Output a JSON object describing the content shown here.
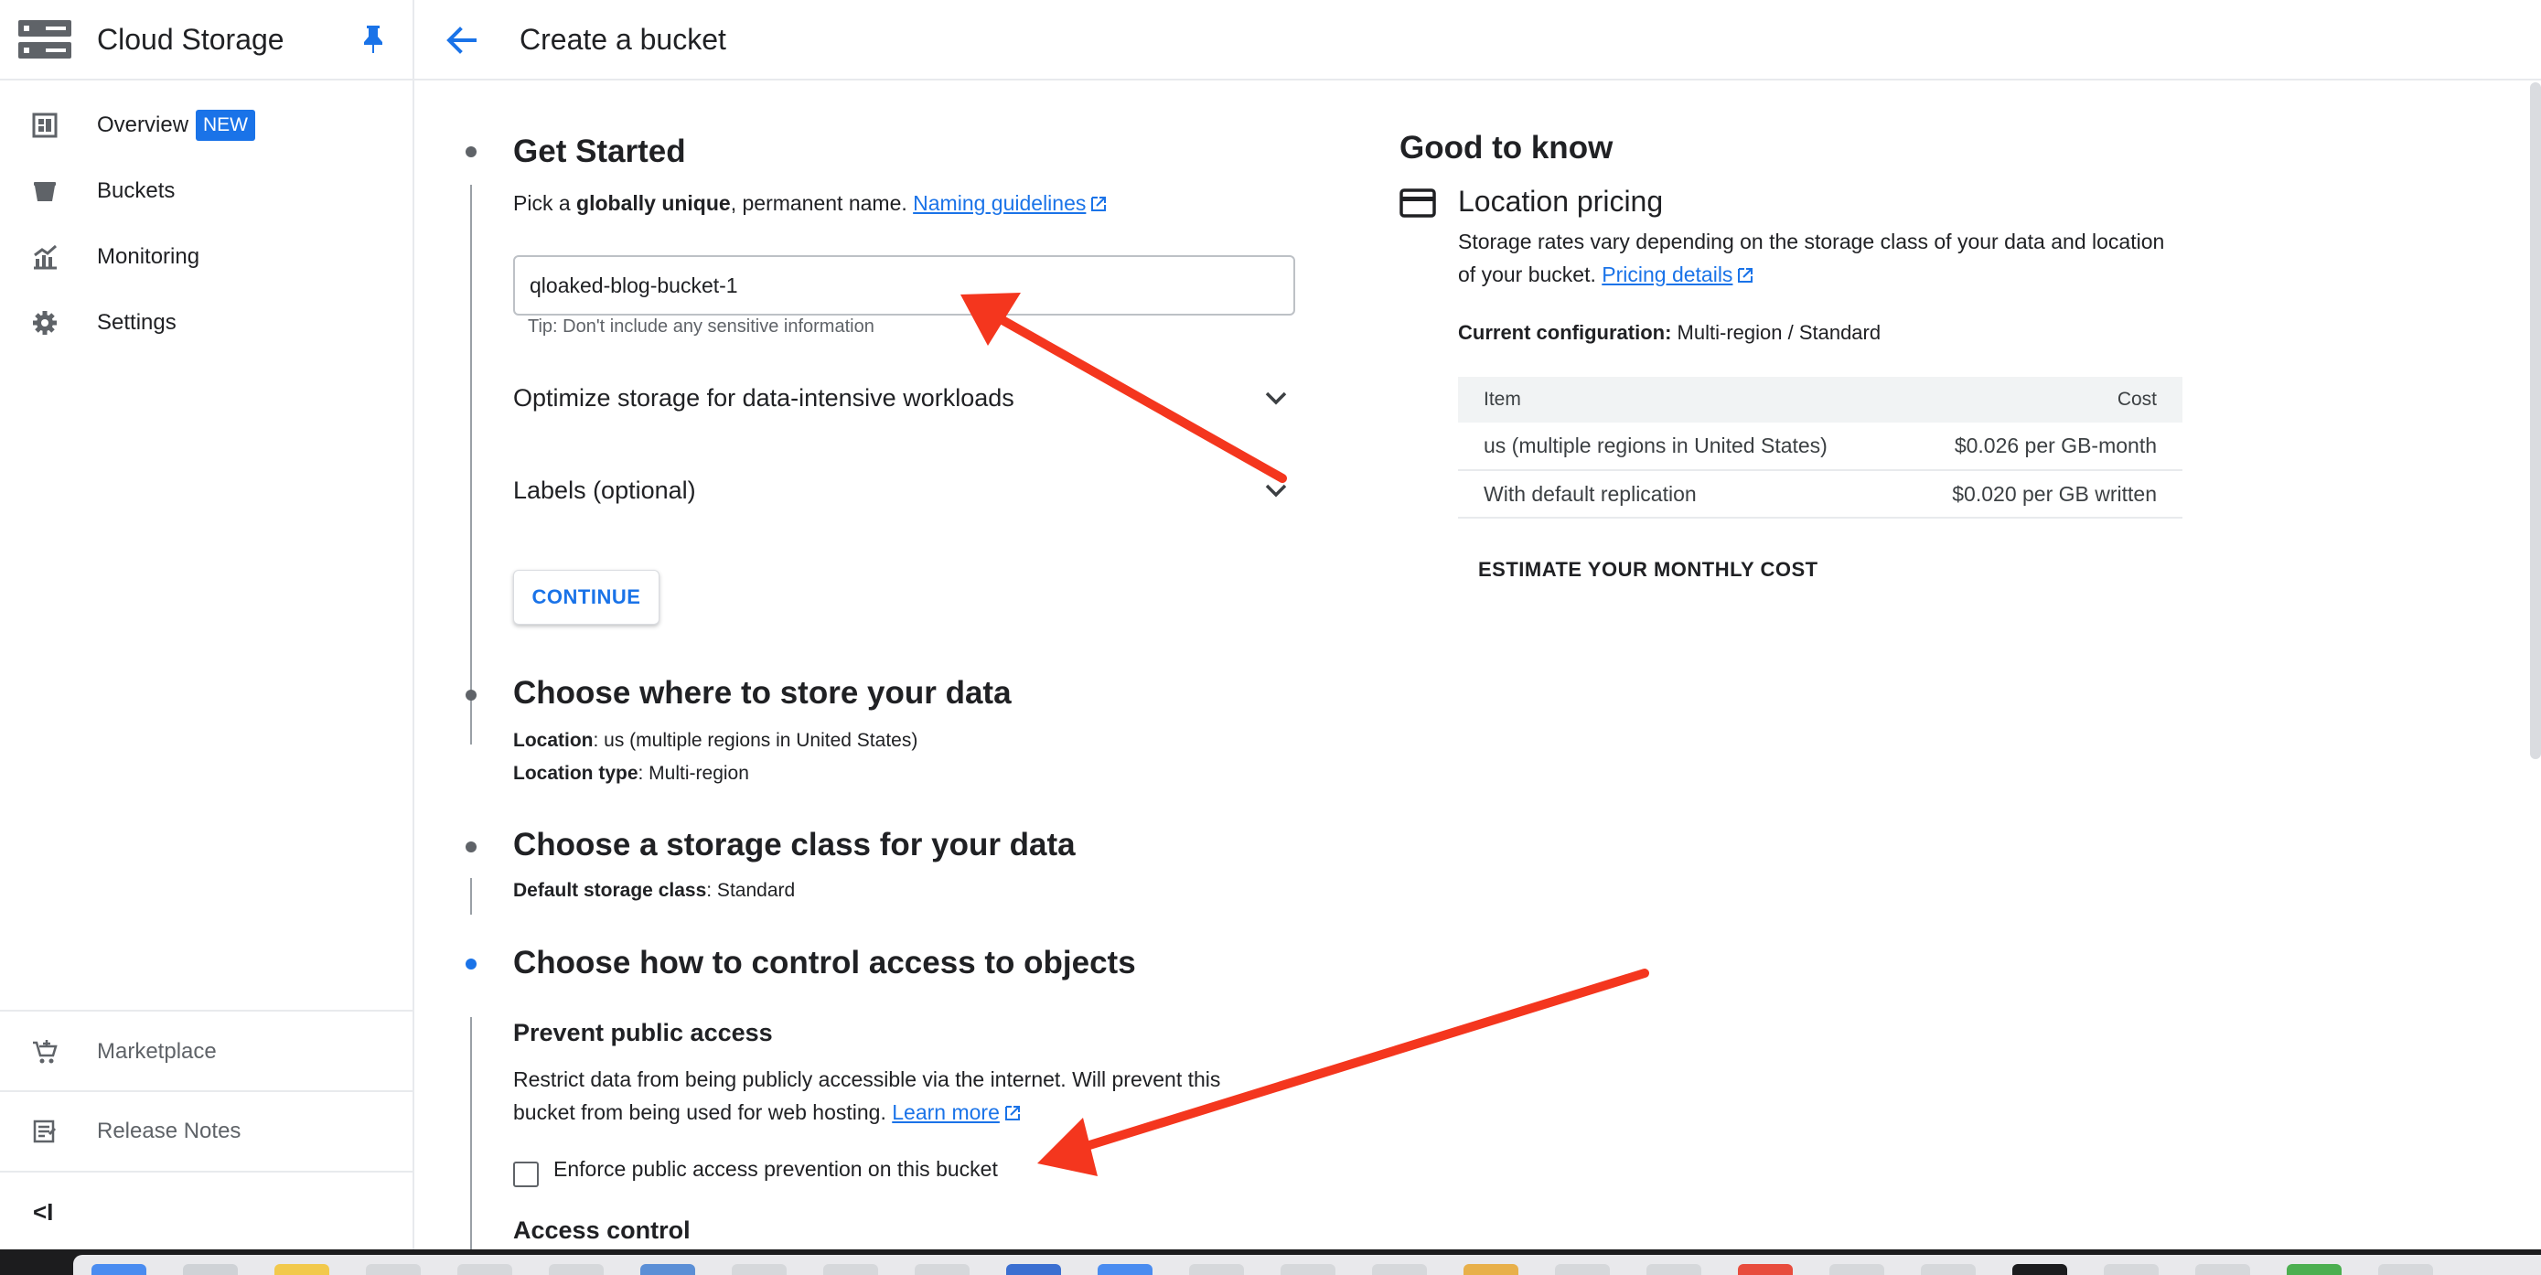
{
  "sidebar": {
    "product_title": "Cloud Storage",
    "items": [
      {
        "label": "Overview",
        "icon": "dashboard-icon",
        "badge": "NEW"
      },
      {
        "label": "Buckets",
        "icon": "bucket-icon"
      },
      {
        "label": "Monitoring",
        "icon": "monitoring-chart-icon"
      },
      {
        "label": "Settings",
        "icon": "gear-icon"
      }
    ],
    "bottom_items": [
      {
        "label": "Marketplace",
        "icon": "marketplace-cart-icon"
      },
      {
        "label": "Release Notes",
        "icon": "release-notes-icon"
      }
    ],
    "collapse_glyph": "<I"
  },
  "header": {
    "title": "Create a bucket"
  },
  "steps": {
    "get_started": {
      "title": "Get Started",
      "desc_prefix": "Pick a ",
      "desc_bold": "globally unique",
      "desc_suffix": ", permanent name.",
      "naming_link": "Naming guidelines",
      "input_value": "qloaked-blog-bucket-1",
      "tip": "Tip: Don't include any sensitive information",
      "optimize_label": "Optimize storage for data-intensive workloads",
      "labels_label": "Labels (optional)",
      "continue_label": "CONTINUE"
    },
    "location": {
      "title": "Choose where to store your data",
      "location_key": "Location",
      "location_value": ": us (multiple regions in United States)",
      "type_key": "Location type",
      "type_value": ": Multi-region"
    },
    "storage_class": {
      "title": "Choose a storage class for your data",
      "key": "Default storage class",
      "value": ": Standard"
    },
    "access": {
      "title": "Choose how to control access to objects",
      "prevent_heading": "Prevent public access",
      "prevent_line1": "Restrict data from being publicly accessible via the internet. Will prevent this",
      "prevent_line2": "bucket from being used for web hosting. ",
      "learn_more": "Learn more",
      "checkbox_label": "Enforce public access prevention on this bucket",
      "access_control_heading": "Access control"
    }
  },
  "good_to_know": {
    "title": "Good to know",
    "location_pricing_title": "Location pricing",
    "desc_line1": "Storage rates vary depending on the storage class of your data and location",
    "desc_line2": "of your bucket. ",
    "pricing_link": "Pricing details",
    "config_key": "Current configuration:",
    "config_value": " Multi-region / Standard",
    "table": {
      "headers": [
        "Item",
        "Cost"
      ],
      "rows": [
        [
          "us (multiple regions in United States)",
          "$0.026 per GB-month"
        ],
        [
          "With default replication",
          "$0.020 per GB written"
        ]
      ]
    },
    "estimate_label": "ESTIMATE YOUR MONTHLY COST"
  },
  "colors": {
    "accent": "#1a73e8",
    "annotation_arrow": "#f4361e",
    "text_primary": "#202124",
    "text_secondary": "#5f6368"
  }
}
